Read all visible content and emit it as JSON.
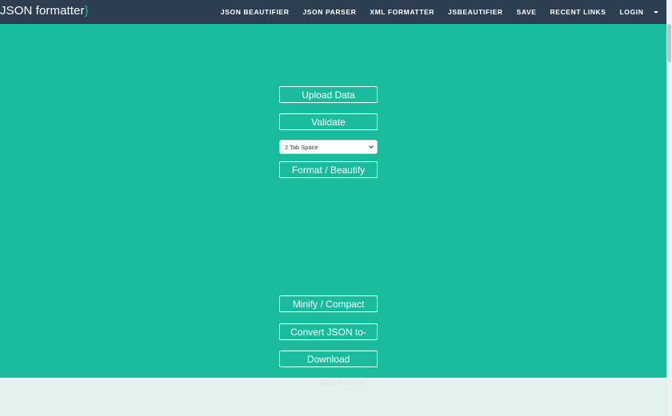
{
  "brand": {
    "text": "JSON formatter",
    "brace": "}"
  },
  "nav": {
    "links": [
      "JSON BEAUTIFIER",
      "JSON PARSER",
      "XML FORMATTER",
      "JSBEAUTIFIER",
      "SAVE",
      "RECENT LINKS",
      "LOGIN"
    ],
    "more_icon": "caret-down-icon"
  },
  "actions": {
    "upload": "Upload Data",
    "validate": "Validate",
    "indent_select": {
      "selected": "2 Tab Space"
    },
    "format": "Format / Beautify",
    "minify": "Minify / Compact",
    "convert": "Convert JSON to-",
    "download": "Download"
  },
  "footer": {
    "text": "JSON Full Form"
  },
  "colors": {
    "navbar": "#2c3e50",
    "accent": "#18bc9c",
    "footer_bg": "#e3f2ef"
  }
}
